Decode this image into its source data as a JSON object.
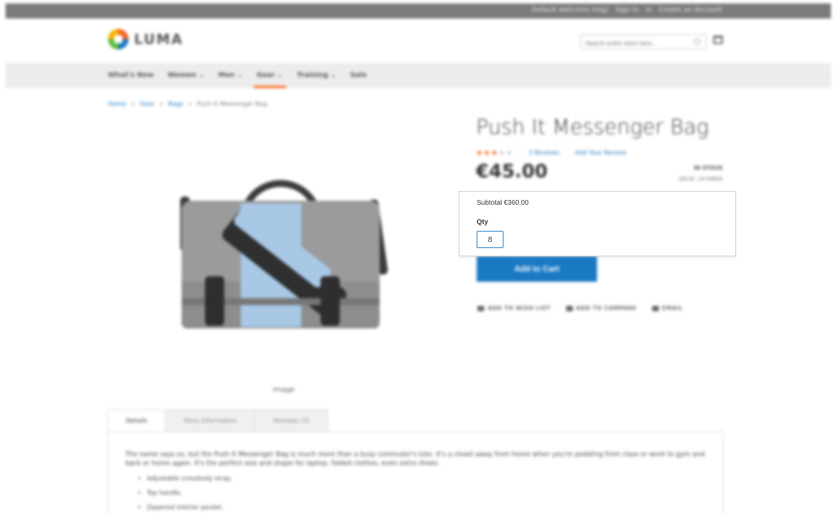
{
  "header": {
    "top_links": [
      "Default welcome msg!",
      "Sign In",
      "or",
      "Create an Account"
    ],
    "brand": "LUMA",
    "search_placeholder": "Search entire store here..."
  },
  "nav": {
    "items": [
      {
        "label": "What's New"
      },
      {
        "label": "Women ⌄"
      },
      {
        "label": "Men ⌄"
      },
      {
        "label": "Gear ⌄",
        "active": true
      },
      {
        "label": "Training ⌄"
      },
      {
        "label": "Sale"
      }
    ]
  },
  "breadcrumb": [
    "Home",
    "Gear",
    "Bags",
    "Push It Messenger Bag"
  ],
  "product": {
    "title": "Push It Messenger Bag",
    "rating_stars": 3,
    "reviews_link": "3 Reviews",
    "add_review_link": "Add Your Review",
    "price": "€45.00",
    "stock": "IN STOCK",
    "sku": "SKU#: 24-WB04",
    "add_to_cart": "Add to Cart",
    "image_label": "Image",
    "actions": [
      "ADD TO WISH LIST",
      "ADD TO COMPARE",
      "EMAIL"
    ]
  },
  "qty_popup": {
    "subtotal": "Subtotal €360.00",
    "qty_label": "Qty",
    "qty_value": "8"
  },
  "tabs": [
    "Details",
    "More Information",
    "Reviews (3)"
  ],
  "details": {
    "description": "The name says so, but the Push It Messenger Bag is much more than a busy commuter's tote. It's a closet away from home when you're pedaling from class or work to gym and back or home again. It's the perfect size and shape for laptop, folded clothes, even extra shoes.",
    "features": [
      "Adjustable crossbody strap.",
      "Top handle.",
      "Zippered interior pocket."
    ]
  },
  "colors": {
    "accent": "#1979c3",
    "active_nav": "#ff5501",
    "star": "#ff5501"
  }
}
